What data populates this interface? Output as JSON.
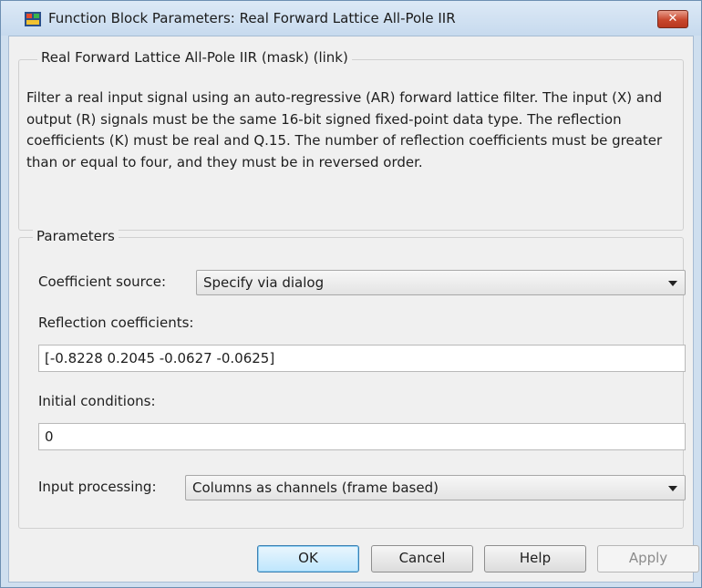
{
  "window": {
    "title": "Function Block Parameters: Real Forward Lattice All-Pole IIR",
    "close_label": "✕"
  },
  "description": {
    "group_title": "Real Forward Lattice All-Pole IIR (mask) (link)",
    "text": "Filter a real input signal using an auto-regressive (AR) forward lattice filter. The input (X) and output (R) signals must be the same 16-bit signed fixed-point data type. The reflection coefficients (K) must be real and Q.15. The number of reflection coefficients must be greater than or equal to four, and they must be in reversed order."
  },
  "parameters": {
    "group_title": "Parameters",
    "coefficient_source": {
      "label": "Coefficient source:",
      "value": "Specify via dialog"
    },
    "reflection_coefficients": {
      "label": "Reflection coefficients:",
      "value": "[-0.8228 0.2045 -0.0627 -0.0625]"
    },
    "initial_conditions": {
      "label": "Initial conditions:",
      "value": "0"
    },
    "input_processing": {
      "label": "Input processing:",
      "value": "Columns as channels (frame based)"
    }
  },
  "buttons": {
    "ok": "OK",
    "cancel": "Cancel",
    "help": "Help",
    "apply": "Apply"
  },
  "colors": {
    "title_bar": "#cfdfef",
    "close_button": "#c8472d",
    "dialog_background": "#f0f0f0",
    "default_button_border": "#3c7fb1"
  }
}
